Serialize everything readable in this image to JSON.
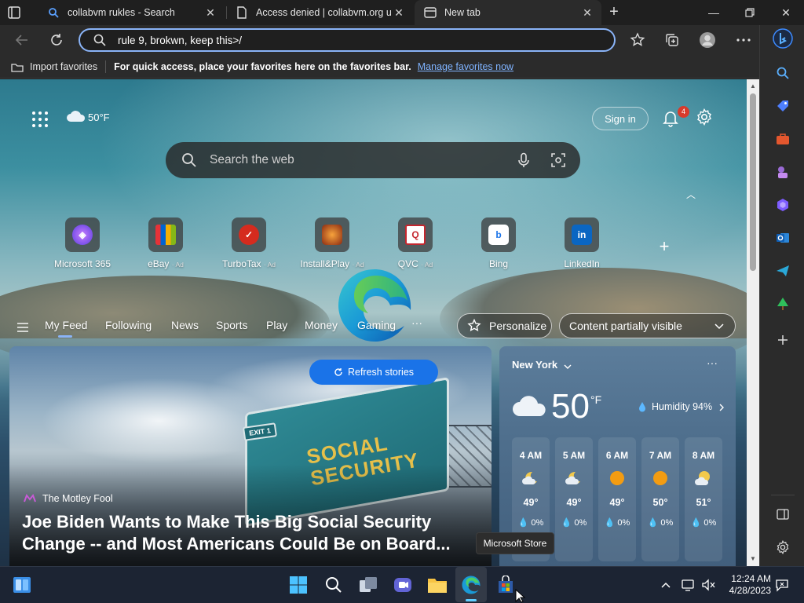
{
  "browser": {
    "tabs": [
      {
        "title": "collabvm rukles - Search",
        "active": false
      },
      {
        "title": "Access denied | collabvm.org use",
        "active": false
      },
      {
        "title": "New tab",
        "active": true
      }
    ],
    "address": "rule 9, brokwn, keep this>/",
    "favorites_bar": {
      "import_label": "Import favorites",
      "message": "For quick access, place your favorites here on the favorites bar.",
      "manage_link": "Manage favorites now"
    }
  },
  "newtab": {
    "weather_mini": "50°F",
    "signin_label": "Sign in",
    "notification_count": "4",
    "search_placeholder": "Search the web",
    "tiles": [
      {
        "label": "Microsoft 365",
        "ad": ""
      },
      {
        "label": "eBay",
        "ad": "· Ad"
      },
      {
        "label": "TurboTax",
        "ad": "· Ad"
      },
      {
        "label": "Install&Play",
        "ad": "· Ad"
      },
      {
        "label": "QVC",
        "ad": "· Ad"
      },
      {
        "label": "Bing",
        "ad": ""
      },
      {
        "label": "LinkedIn",
        "ad": ""
      }
    ],
    "feed_tabs": [
      "My Feed",
      "Following",
      "News",
      "Sports",
      "Play",
      "Money",
      "Gaming"
    ],
    "feed_more": "···",
    "personalize_label": "Personalize",
    "visibility_label": "Content partially visible",
    "refresh_label": "Refresh stories",
    "hero": {
      "sign_text": "SOCIAL SECURITY",
      "exit_text": "EXIT 1",
      "source": "The Motley Fool",
      "headline": "Joe Biden Wants to Make This Big Social Security Change -- and Most Americans Could Be on Board..."
    },
    "weather": {
      "location": "New York",
      "more": "···",
      "temp": "50",
      "unit": "°F",
      "humidity": "Humidity 94%",
      "hours": [
        {
          "time": "4 AM",
          "temp": "49°",
          "precip": "0%"
        },
        {
          "time": "5 AM",
          "temp": "49°",
          "precip": "0%"
        },
        {
          "time": "6 AM",
          "temp": "49°",
          "precip": "0%"
        },
        {
          "time": "7 AM",
          "temp": "50°",
          "precip": "0%"
        },
        {
          "time": "8 AM",
          "temp": "51°",
          "precip": "0%"
        }
      ]
    }
  },
  "tooltip": "Microsoft Store",
  "taskbar": {
    "time": "12:24 AM",
    "date": "4/28/2023"
  }
}
